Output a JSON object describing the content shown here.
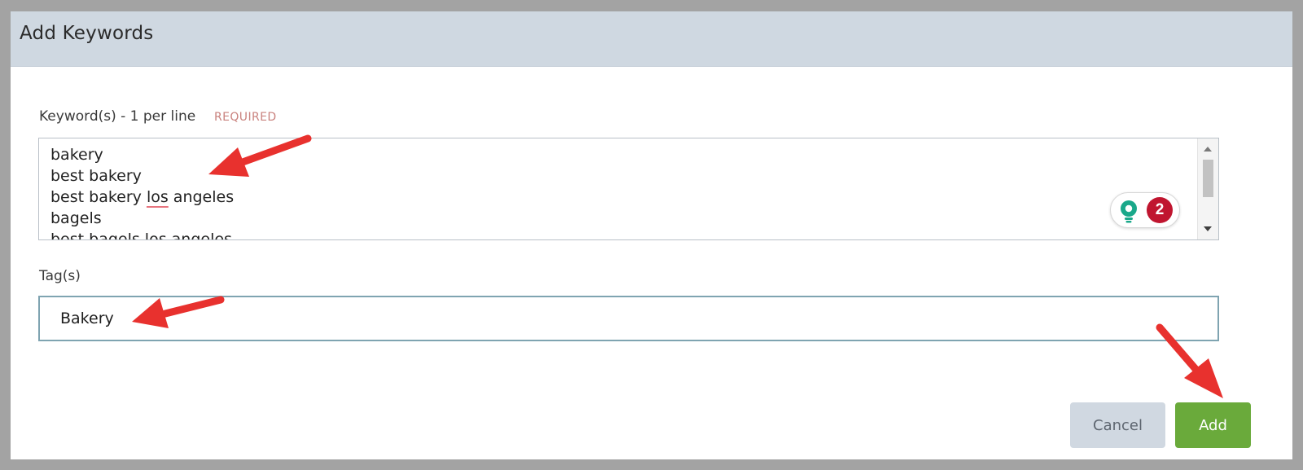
{
  "dialog": {
    "title": "Add Keywords"
  },
  "keywords_field": {
    "label": "Keyword(s) - 1 per line",
    "required_label": "REQUIRED",
    "lines": [
      "bakery",
      "best bakery",
      "best bakery los angeles",
      "bagels",
      "best bagels los angeles"
    ]
  },
  "grammar_widget": {
    "icon": "lightbulb-icon",
    "count": "2",
    "icon_color": "#1aa88a",
    "badge_color": "#c0152f"
  },
  "tags_field": {
    "label": "Tag(s)",
    "value": "Bakery"
  },
  "buttons": {
    "cancel_label": "Cancel",
    "add_label": "Add"
  },
  "colors": {
    "header_bg": "#cfd8e1",
    "add_button": "#6aaa3b",
    "cancel_button": "#d0d8e1",
    "required_text": "#c9817d",
    "annotation_arrow": "#e8312e"
  }
}
